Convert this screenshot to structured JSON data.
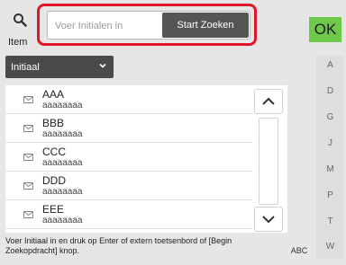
{
  "header": {
    "search_mode_label": "Item",
    "input_placeholder": "Voer Initialen in",
    "start_label": "Start Zoeken",
    "ok_label": "OK",
    "highlight_color": "#e0162b",
    "ok_color": "#6ec94a"
  },
  "filter": {
    "selected": "Initiaal"
  },
  "contacts": [
    {
      "name": "AAA",
      "sub": "aaaaaaaa"
    },
    {
      "name": "BBB",
      "sub": "aaaaaaaa"
    },
    {
      "name": "CCC",
      "sub": "aaaaaaaa"
    },
    {
      "name": "DDD",
      "sub": "aaaaaaaa"
    },
    {
      "name": "EEE",
      "sub": "aaaaaaaa"
    }
  ],
  "alphabet": [
    "A",
    "D",
    "G",
    "J",
    "M",
    "P",
    "T",
    "W"
  ],
  "footer": {
    "hint": "Voer Initiaal in en druk op Enter of extern toetsenbord of [Begin Zoekopdracht] knop.",
    "abc_label": "ABC"
  },
  "icons": [
    "search-icon",
    "chevron-down-icon",
    "mail-icon",
    "chevron-up-icon"
  ]
}
